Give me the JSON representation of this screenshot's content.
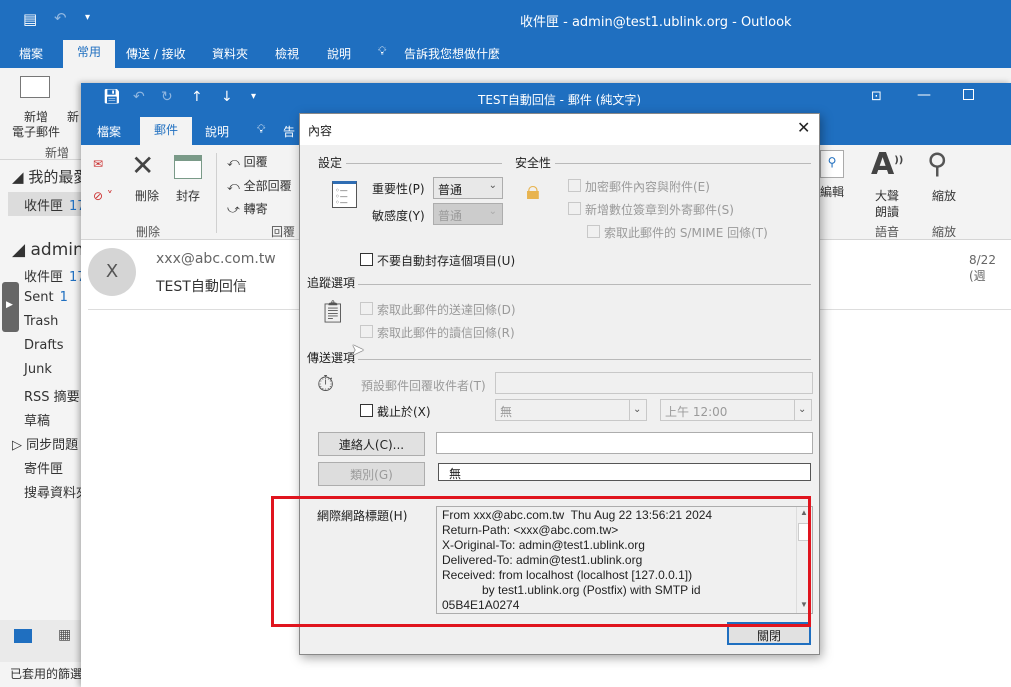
{
  "main_window": {
    "title": "收件匣 - admin@test1.ublink.org - Outlook",
    "tabs": [
      "檔案",
      "常用",
      "傳送 / 接收",
      "資料夾",
      "檢視",
      "說明"
    ],
    "active_tab": "常用",
    "tell_me": "告訴我您想做什麼",
    "ribbon": {
      "new_email": "新增\n電子郵件",
      "new_email_l1": "新增",
      "new_email_l2": "電子郵件",
      "new_other": "新",
      "group_new": "新增"
    },
    "favorites": "我的最愛",
    "fav_inbox": {
      "label": "收件匣",
      "count": "17"
    },
    "account": "admin@",
    "folders": [
      {
        "label": "收件匣",
        "count": "17"
      },
      {
        "label": "Sent",
        "count": "1"
      },
      {
        "label": "Trash",
        "count": ""
      },
      {
        "label": "Drafts",
        "count": ""
      },
      {
        "label": "Junk",
        "count": ""
      },
      {
        "label": "RSS 摘要",
        "count": ""
      },
      {
        "label": "草稿",
        "count": ""
      },
      {
        "label": "同步問題",
        "count": ""
      },
      {
        "label": "寄件匣",
        "count": ""
      },
      {
        "label": "搜尋資料夾",
        "count": ""
      }
    ],
    "status_bar": "已套用的篩選"
  },
  "message_window": {
    "title": "TEST自動回信 - 郵件 (純文字)",
    "tabs": [
      "檔案",
      "郵件",
      "說明"
    ],
    "active_tab": "郵件",
    "tell_me": "告",
    "ribbon": {
      "delete": "刪除",
      "archive": "封存",
      "group_delete": "刪除",
      "reply": "回覆",
      "reply_all": "全部回覆",
      "forward": "轉寄",
      "group_reply": "回覆",
      "edit": "編輯",
      "read_aloud_1": "大聲",
      "read_aloud_2": "朗讀",
      "group_speech": "語音",
      "zoom": "縮放",
      "group_zoom": "縮放"
    },
    "sender": "xxx@abc.com.tw",
    "avatar_initial": "X",
    "subject": "TEST自動回信",
    "date": "8/22 (週"
  },
  "dialog": {
    "title": "內容",
    "settings": {
      "heading": "設定",
      "importance_label": "重要性(P)",
      "importance_value": "普通",
      "sensitivity_label": "敏感度(Y)",
      "sensitivity_value": "普通",
      "no_autoarchive": "不要自動封存這個項目(U)"
    },
    "security": {
      "heading": "安全性",
      "encrypt": "加密郵件內容與附件(E)",
      "sign": "新增數位簽章到外寄郵件(S)",
      "smime_receipt": "索取此郵件的 S/MIME 回條(T)"
    },
    "tracking": {
      "heading": "追蹤選項",
      "delivery_receipt": "索取此郵件的送達回條(D)",
      "read_receipt": "索取此郵件的讀信回條(R)"
    },
    "delivery": {
      "heading": "傳送選項",
      "reply_to_label": "預設郵件回覆收件者(T)",
      "reply_to_value": "",
      "expires_label": "截止於(X)",
      "expires_date": "無",
      "expires_time": "上午 12:00"
    },
    "contacts_button": "連絡人(C)...",
    "contacts_value": "",
    "categories_button": "類別(G)",
    "categories_value": "無",
    "headers_label": "網際網路標題(H)",
    "headers_lines": [
      "From xxx@abc.com.tw  Thu Aug 22 13:56:21 2024",
      "Return-Path: <xxx@abc.com.tw>",
      "X-Original-To: admin@test1.ublink.org",
      "Delivered-To: admin@test1.ublink.org",
      "Received: from localhost (localhost [127.0.0.1])",
      "            by test1.ublink.org (Postfix) with SMTP id",
      "05B4E1A0274"
    ],
    "close_button": "關閉"
  },
  "colors": {
    "accent": "#1f6fc0",
    "highlight_box": "#e0141e",
    "dialog_bg": "#f0f0f0"
  }
}
